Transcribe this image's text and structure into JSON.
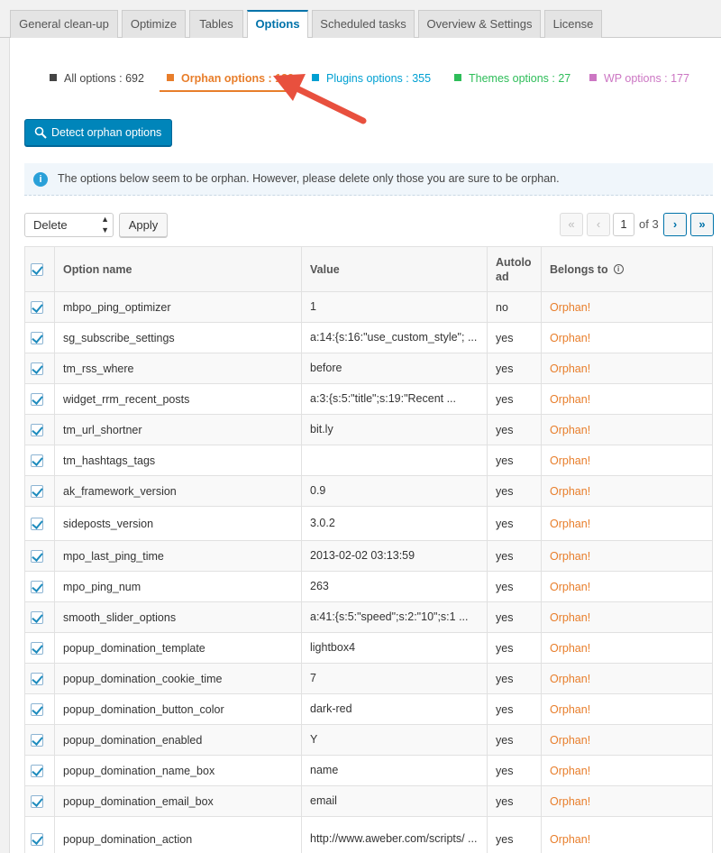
{
  "tabs": [
    {
      "label": "General clean-up",
      "active": false
    },
    {
      "label": "Optimize",
      "active": false
    },
    {
      "label": "Tables",
      "active": false
    },
    {
      "label": "Options",
      "active": true
    },
    {
      "label": "Scheduled tasks",
      "active": false
    },
    {
      "label": "Overview & Settings",
      "active": false
    },
    {
      "label": "License",
      "active": false
    }
  ],
  "filters": [
    {
      "label": "All options : 692",
      "color": "#444444",
      "active": false
    },
    {
      "label": "Orphan options : 132",
      "color": "#e87e2b",
      "active": true
    },
    {
      "label": "Plugins options : 355",
      "color": "#00a0d2",
      "active": false
    },
    {
      "label": "Themes options : 27",
      "color": "#2ebd59",
      "active": false
    },
    {
      "label": "WP options : 177",
      "color": "#cc76c3",
      "active": false
    }
  ],
  "detect_button": {
    "label": "Detect orphan options",
    "icon": "magnifier-icon"
  },
  "notice": {
    "text": "The options below seem to be orphan. However, please delete only those you are sure to be orphan."
  },
  "bulk": {
    "selected": "Delete",
    "apply_label": "Apply"
  },
  "pagination": {
    "current": "1",
    "of_label": "of 3",
    "first": "«",
    "prev": "‹",
    "next": "›",
    "last": "»"
  },
  "table": {
    "headers": {
      "name": "Option name",
      "value": "Value",
      "autoload": "Autolo ad",
      "belongs": "Belongs to"
    },
    "rows": [
      {
        "name": "mbpo_ping_optimizer",
        "value": "1",
        "autoload": "no",
        "belongs": "Orphan!"
      },
      {
        "name": "sg_subscribe_settings",
        "value": "a:14:{s:16:\"use_custom_style\"; ...",
        "autoload": "yes",
        "belongs": "Orphan!"
      },
      {
        "name": "tm_rss_where",
        "value": "before",
        "autoload": "yes",
        "belongs": "Orphan!"
      },
      {
        "name": "widget_rrm_recent_posts",
        "value": "a:3:{s:5:\"title\";s:19:\"Recent ...",
        "autoload": "yes",
        "belongs": "Orphan!"
      },
      {
        "name": "tm_url_shortner",
        "value": "bit.ly",
        "autoload": "yes",
        "belongs": "Orphan!"
      },
      {
        "name": "tm_hashtags_tags",
        "value": "",
        "autoload": "yes",
        "belongs": "Orphan!"
      },
      {
        "name": "ak_framework_version",
        "value": "0.9",
        "autoload": "yes",
        "belongs": "Orphan!"
      },
      {
        "name": "sideposts_version",
        "value": "3.0.2",
        "autoload": "yes",
        "belongs": "Orphan!"
      },
      {
        "name": "mpo_last_ping_time",
        "value": "2013-02-02 03:13:59",
        "autoload": "yes",
        "belongs": "Orphan!"
      },
      {
        "name": "mpo_ping_num",
        "value": "263",
        "autoload": "yes",
        "belongs": "Orphan!"
      },
      {
        "name": "smooth_slider_options",
        "value": "a:41:{s:5:\"speed\";s:2:\"10\";s:1 ...",
        "autoload": "yes",
        "belongs": "Orphan!"
      },
      {
        "name": "popup_domination_template",
        "value": "lightbox4",
        "autoload": "yes",
        "belongs": "Orphan!"
      },
      {
        "name": "popup_domination_cookie_time",
        "value": "7",
        "autoload": "yes",
        "belongs": "Orphan!"
      },
      {
        "name": "popup_domination_button_color",
        "value": "dark-red",
        "autoload": "yes",
        "belongs": "Orphan!"
      },
      {
        "name": "popup_domination_enabled",
        "value": "Y",
        "autoload": "yes",
        "belongs": "Orphan!"
      },
      {
        "name": "popup_domination_name_box",
        "value": "name",
        "autoload": "yes",
        "belongs": "Orphan!"
      },
      {
        "name": "popup_domination_email_box",
        "value": "email",
        "autoload": "yes",
        "belongs": "Orphan!"
      },
      {
        "name": "popup_domination_action",
        "value": "http://www.aweber.com/scripts/ ...",
        "autoload": "yes",
        "belongs": "Orphan!"
      }
    ]
  }
}
